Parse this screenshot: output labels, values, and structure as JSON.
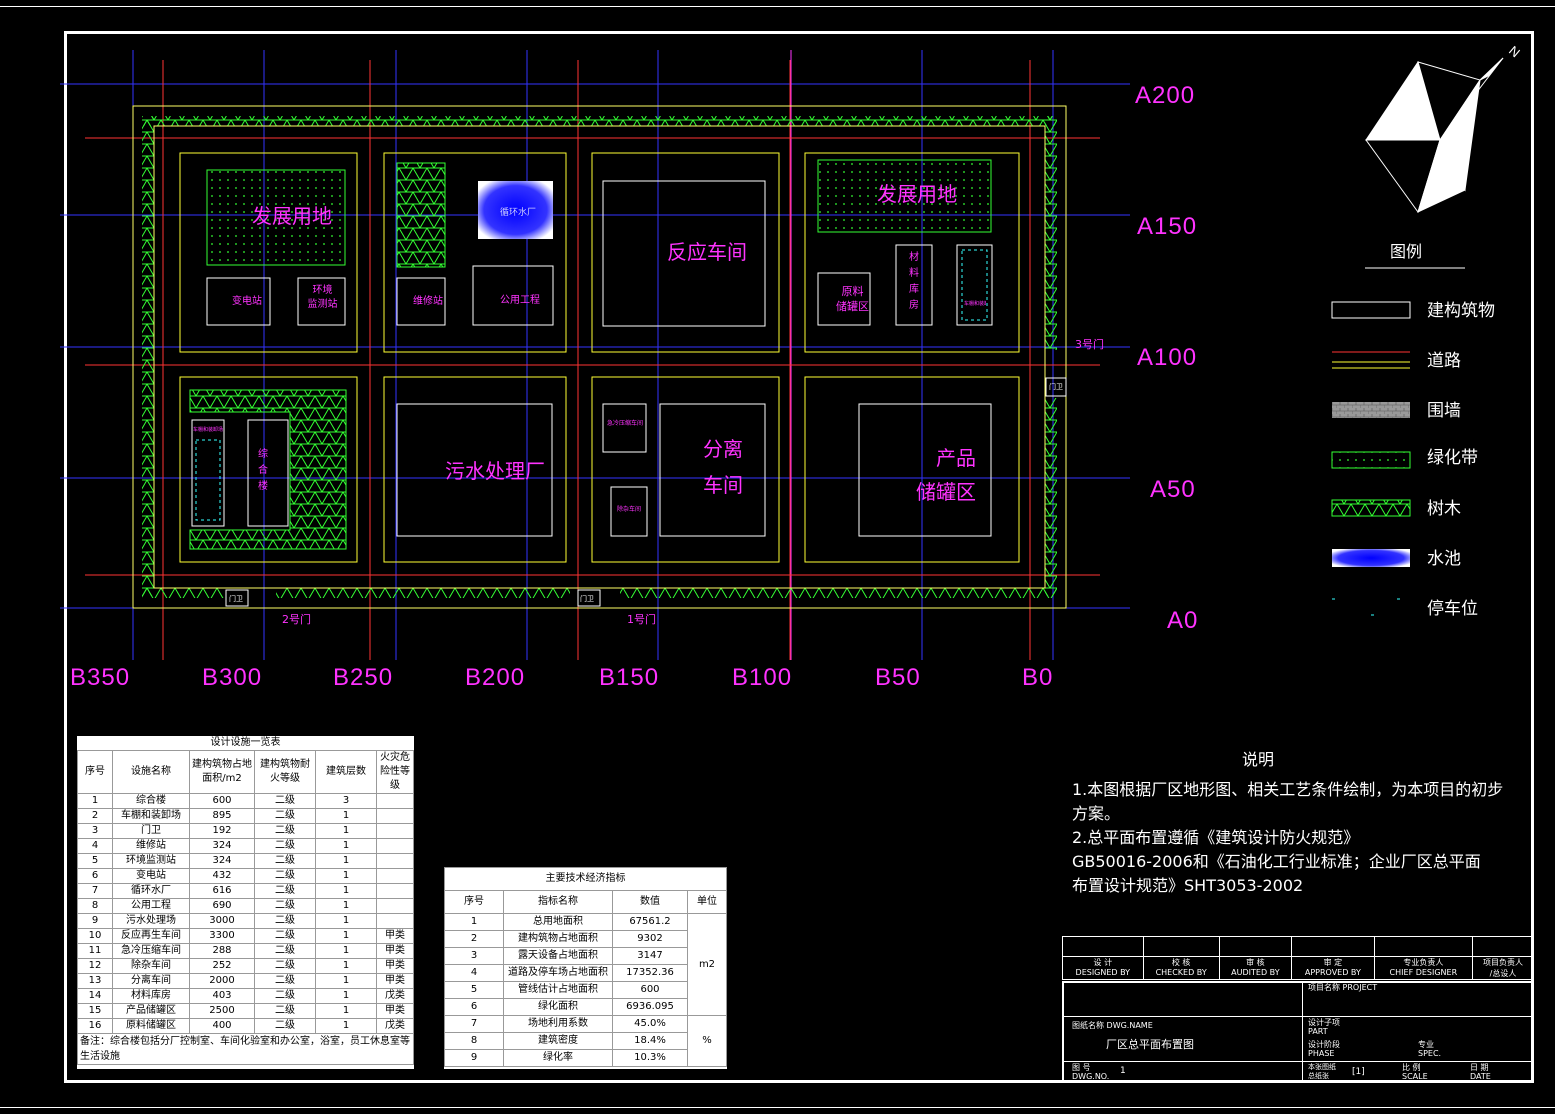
{
  "compass_label": "N",
  "axes": {
    "a_labels": [
      "A200",
      "A150",
      "A100",
      "A50",
      "A0"
    ],
    "b_labels": [
      "B350",
      "B300",
      "B250",
      "B200",
      "B150",
      "B100",
      "B50",
      "B0"
    ]
  },
  "plan": {
    "dev_land_1": "发展用地",
    "dev_land_2": "发展用地",
    "substation": "变电站",
    "env_station": "环境\n监测站",
    "repair": "维修站",
    "pool": "循环水厂",
    "utility": "公用工程",
    "reaction": "反应车间",
    "raw_tank": "原料\n储罐区",
    "material_store": "材\n料\n库\n房",
    "parking_label": "车棚和装卸场",
    "office_small": "车棚和装卸场",
    "complex": "综\n合\n楼",
    "sewage": "污水处理厂",
    "quench": "急冷压缩车间",
    "separation": "分离\n车间",
    "removal": "除杂车间",
    "product": "产品\n储罐区",
    "gate3": "3号门",
    "gate2": "2号门",
    "gate1": "1号门",
    "guard": "门卫"
  },
  "legend": {
    "title": "图例",
    "items": [
      "建构筑物",
      "道路",
      "围墙",
      "绿化带",
      "树木",
      "水池",
      "停车位"
    ]
  },
  "notes": {
    "title": "说明",
    "lines": [
      "1.本图根据厂区地形图、相关工艺条件绘制，为本项目的初步",
      "方案。",
      "2.总平面布置遵循《建筑设计防火规范》",
      "GB50016-2006和《石油化工行业标准；企业厂区总平面",
      "布置设计规范》SHT3053-2002"
    ]
  },
  "facilities": {
    "title": "设计设施一览表",
    "headers": [
      "序号",
      "设施名称",
      "建构筑物占地面积/m2",
      "建构筑物耐火等级",
      "建筑层数",
      "火灾危险性等级"
    ],
    "rows": [
      [
        "1",
        "综合楼",
        "600",
        "二级",
        "3",
        ""
      ],
      [
        "2",
        "车棚和装卸场",
        "895",
        "二级",
        "1",
        ""
      ],
      [
        "3",
        "门卫",
        "192",
        "二级",
        "1",
        ""
      ],
      [
        "4",
        "维修站",
        "324",
        "二级",
        "1",
        ""
      ],
      [
        "5",
        "环境监测站",
        "324",
        "二级",
        "1",
        ""
      ],
      [
        "6",
        "变电站",
        "432",
        "二级",
        "1",
        ""
      ],
      [
        "7",
        "循环水厂",
        "616",
        "二级",
        "1",
        ""
      ],
      [
        "8",
        "公用工程",
        "690",
        "二级",
        "1",
        ""
      ],
      [
        "9",
        "污水处理场",
        "3000",
        "二级",
        "1",
        ""
      ],
      [
        "10",
        "反应再生车间",
        "3300",
        "二级",
        "1",
        "甲类"
      ],
      [
        "11",
        "急冷压缩车间",
        "288",
        "二级",
        "1",
        "甲类"
      ],
      [
        "12",
        "除杂车间",
        "252",
        "二级",
        "1",
        "甲类"
      ],
      [
        "13",
        "分离车间",
        "2000",
        "二级",
        "1",
        "甲类"
      ],
      [
        "14",
        "材料库房",
        "403",
        "二级",
        "1",
        "戊类"
      ],
      [
        "15",
        "产品储罐区",
        "2500",
        "二级",
        "1",
        "甲类"
      ],
      [
        "16",
        "原料储罐区",
        "400",
        "二级",
        "1",
        "戊类"
      ]
    ],
    "note": "备注：综合楼包括分厂控制室、车间化验室和办公室，浴室，员工休息室等生活设施"
  },
  "indicators": {
    "title": "主要技术经济指标",
    "headers": [
      "序号",
      "指标名称",
      "数值",
      "单位"
    ],
    "rows": [
      [
        "1",
        "总用地面积",
        "67561.2"
      ],
      [
        "2",
        "建构筑物占地面积",
        "9302"
      ],
      [
        "3",
        "露天设备占地面积",
        "3147"
      ],
      [
        "4",
        "道路及停车场占地面积",
        "17352.36"
      ],
      [
        "5",
        "管线估计占地面积",
        "600"
      ],
      [
        "6",
        "绿化面积",
        "6936.095"
      ],
      [
        "7",
        "场地利用系数",
        "45.0%"
      ],
      [
        "8",
        "建筑密度",
        "18.4%"
      ],
      [
        "9",
        "绿化率",
        "10.3%"
      ]
    ],
    "unit_m2": "m2",
    "unit_pct": "%"
  },
  "title_block": {
    "designed": "设 计\nDESIGNED BY",
    "checked": "校 核\nCHECKED BY",
    "audited": "审 核\nAUDITED BY",
    "approved": "审 定\nAPPROVED BY",
    "chief": "专业负责人\nCHIEF DESIGNER",
    "project_lead": "项目负责人\n/总设人",
    "project": "项目名称 PROJECT",
    "dwg_name_label": "图纸名称 DWG.NAME",
    "dwg_name": "厂区总平面布置图",
    "part": "设计子项\nPART",
    "phase": "设计阶段\nPHASE",
    "spec": "专业\nSPEC.",
    "dwg_no_label": "图 号\nDWG.NO.",
    "dwg_no": "1",
    "scale_label": "比 例\nSCALE",
    "scale_val": "[1]",
    "date_label": "日 期\nDATE",
    "sheet_label": "本张图纸\n总纸张"
  }
}
